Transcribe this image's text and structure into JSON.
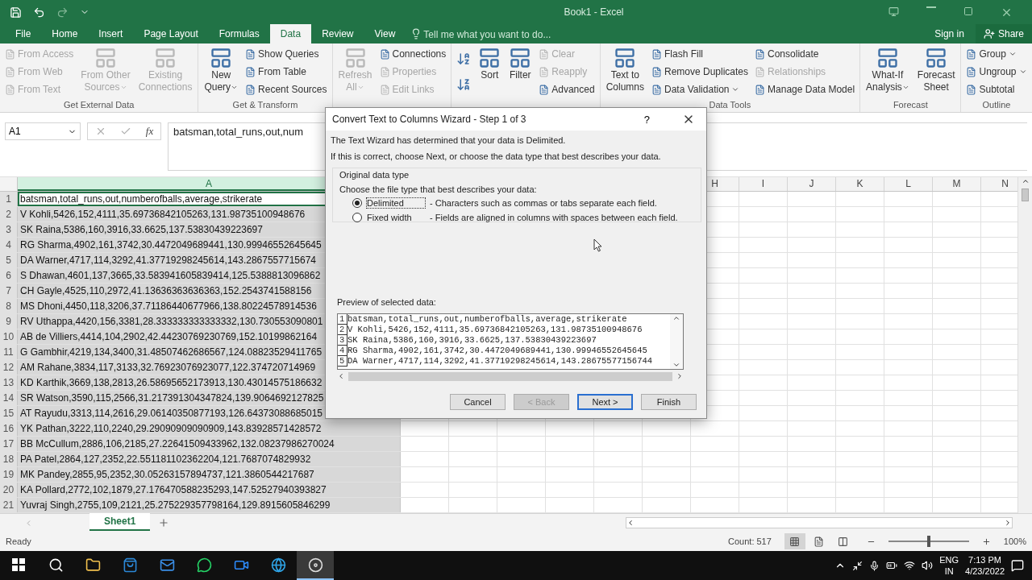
{
  "title_bar": {
    "title": "Book1 - Excel"
  },
  "menu_tabs": [
    {
      "label": "File",
      "selected": false
    },
    {
      "label": "Home",
      "selected": false
    },
    {
      "label": "Insert",
      "selected": false
    },
    {
      "label": "Page Layout",
      "selected": false
    },
    {
      "label": "Formulas",
      "selected": false
    },
    {
      "label": "Data",
      "selected": true
    },
    {
      "label": "Review",
      "selected": false
    },
    {
      "label": "View",
      "selected": false
    }
  ],
  "tell_me": {
    "placeholder": "Tell me what you want to do..."
  },
  "account": {
    "sign_in": "Sign in",
    "share": "Share"
  },
  "ribbon_groups": [
    {
      "title": "Get External Data",
      "items": [
        {
          "kind": "small",
          "label": "From Access",
          "disabled": true
        },
        {
          "kind": "small",
          "label": "From Web",
          "disabled": true
        },
        {
          "kind": "small",
          "label": "From Text",
          "disabled": true
        },
        {
          "kind": "large",
          "lines": [
            "From Other",
            "Sources"
          ],
          "dropdown": true,
          "disabled": true
        },
        {
          "kind": "large",
          "lines": [
            "Existing",
            "Connections"
          ],
          "dropdown": false,
          "disabled": true
        }
      ]
    },
    {
      "title": "Get & Transform",
      "items": [
        {
          "kind": "large",
          "lines": [
            "New",
            "Query"
          ],
          "dropdown": true,
          "disabled": false
        },
        {
          "kind": "small",
          "label": "Show Queries",
          "disabled": false
        },
        {
          "kind": "small",
          "label": "From Table",
          "disabled": false
        },
        {
          "kind": "small",
          "label": "Recent Sources",
          "disabled": false
        }
      ]
    },
    {
      "items": [
        {
          "kind": "large",
          "lines": [
            "Refresh",
            "All"
          ],
          "dropdown": true,
          "disabled": true
        },
        {
          "kind": "small",
          "label": "Connections",
          "disabled": false
        },
        {
          "kind": "small",
          "label": "Properties",
          "disabled": true
        },
        {
          "kind": "small",
          "label": "Edit Links",
          "disabled": true
        }
      ]
    },
    {
      "items": [
        {
          "kind": "sort_pair"
        },
        {
          "kind": "large",
          "lines": [
            "Sort"
          ],
          "dropdown": false,
          "disabled": false
        },
        {
          "kind": "large",
          "lines": [
            "Filter"
          ],
          "dropdown": false,
          "disabled": false
        },
        {
          "kind": "small",
          "label": "Clear",
          "disabled": true
        },
        {
          "kind": "small",
          "label": "Reapply",
          "disabled": true
        },
        {
          "kind": "small",
          "label": "Advanced",
          "disabled": false
        }
      ]
    },
    {
      "title": "Data Tools",
      "items": [
        {
          "kind": "large",
          "lines": [
            "Text to",
            "Columns"
          ],
          "dropdown": false,
          "disabled": false
        },
        {
          "kind": "small",
          "label": "Flash Fill",
          "disabled": false
        },
        {
          "kind": "small",
          "label": "Remove Duplicates",
          "disabled": false
        },
        {
          "kind": "small",
          "label": "Data Validation",
          "disabled": false,
          "dropdown": true
        },
        {
          "kind": "small",
          "label": "Consolidate",
          "disabled": false
        },
        {
          "kind": "small",
          "label": "Relationships",
          "disabled": true
        },
        {
          "kind": "small",
          "label": "Manage Data Model",
          "disabled": false
        }
      ]
    },
    {
      "title": "Forecast",
      "items": [
        {
          "kind": "large",
          "lines": [
            "What-If",
            "Analysis"
          ],
          "dropdown": true,
          "disabled": false
        },
        {
          "kind": "large",
          "lines": [
            "Forecast",
            "Sheet"
          ],
          "dropdown": false,
          "disabled": false
        }
      ]
    },
    {
      "title": "Outline",
      "items": [
        {
          "kind": "small",
          "label": "Group",
          "disabled": false,
          "dropdown": true
        },
        {
          "kind": "small",
          "label": "Ungroup",
          "disabled": false,
          "dropdown": true
        },
        {
          "kind": "small",
          "label": "Subtotal",
          "disabled": false
        }
      ]
    }
  ],
  "formula_bar": {
    "name_box": "A1",
    "function_button": "fx",
    "formula": "batsman,total_runs,out,num"
  },
  "columns": [
    {
      "label": "A",
      "selected": true
    },
    {
      "label": "H",
      "selected": false
    },
    {
      "label": "I",
      "selected": false
    },
    {
      "label": "J",
      "selected": false
    },
    {
      "label": "K",
      "selected": false
    },
    {
      "label": "L",
      "selected": false
    },
    {
      "label": "M",
      "selected": false
    },
    {
      "label": "N",
      "selected": false
    }
  ],
  "rows": [
    {
      "number": "1",
      "cell": "batsman,total_runs,out,numberofballs,average,strikerate",
      "active": true
    },
    {
      "number": "2",
      "cell": "V Kohli,5426,152,4111,35.69736842105263,131.98735100948676",
      "active": false
    },
    {
      "number": "3",
      "cell": "SK Raina,5386,160,3916,33.6625,137.53830439223697",
      "active": false
    },
    {
      "number": "4",
      "cell": "RG Sharma,4902,161,3742,30.4472049689441,130.99946552645645",
      "active": false
    },
    {
      "number": "5",
      "cell": "DA Warner,4717,114,3292,41.37719298245614,143.2867557715674",
      "active": false
    },
    {
      "number": "6",
      "cell": "S Dhawan,4601,137,3665,33.583941605839414,125.5388813096862",
      "active": false
    },
    {
      "number": "7",
      "cell": "CH Gayle,4525,110,2972,41.13636363636363,152.2543741588156",
      "active": false
    },
    {
      "number": "8",
      "cell": "MS Dhoni,4450,118,3206,37.71186440677966,138.80224578914536",
      "active": false
    },
    {
      "number": "9",
      "cell": "RV Uthappa,4420,156,3381,28.333333333333332,130.730553090801",
      "active": false
    },
    {
      "number": "10",
      "cell": "AB de Villiers,4414,104,2902,42.44230769230769,152.10199862164",
      "active": false
    },
    {
      "number": "11",
      "cell": "G Gambhir,4219,134,3400,31.48507462686567,124.08823529411765",
      "active": false
    },
    {
      "number": "12",
      "cell": "AM Rahane,3834,117,3133,32.76923076923077,122.374720714969",
      "active": false
    },
    {
      "number": "13",
      "cell": "KD Karthik,3669,138,2813,26.58695652173913,130.43014575186632",
      "active": false
    },
    {
      "number": "14",
      "cell": "SR Watson,3590,115,2566,31.217391304347824,139.9064692127825",
      "active": false
    },
    {
      "number": "15",
      "cell": "AT Rayudu,3313,114,2616,29.06140350877193,126.64373088685015",
      "active": false
    },
    {
      "number": "16",
      "cell": "YK Pathan,3222,110,2240,29.29090909090909,143.83928571428572",
      "active": false
    },
    {
      "number": "17",
      "cell": "BB McCullum,2886,106,2185,27.22641509433962,132.08237986270024",
      "active": false
    },
    {
      "number": "18",
      "cell": "PA Patel,2864,127,2352,22.551181102362204,121.7687074829932",
      "active": false
    },
    {
      "number": "19",
      "cell": "MK Pandey,2855,95,2352,30.05263157894737,121.3860544217687",
      "active": false
    },
    {
      "number": "20",
      "cell": "KA Pollard,2772,102,1879,27.176470588235293,147.52527940393827",
      "active": false
    },
    {
      "number": "21",
      "cell": "Yuvraj Singh,2755,109,2121,25.275229357798164,129.8915605846299",
      "active": false
    }
  ],
  "sheet_tabs": [
    {
      "label": "Sheet1",
      "selected": true
    }
  ],
  "status_bar": {
    "status": "Ready",
    "count": "Count: 517",
    "views": [
      {
        "selected": true
      },
      {
        "selected": false
      },
      {
        "selected": false
      }
    ],
    "zoom": {
      "level": 0.5,
      "reading": "100%"
    }
  },
  "dialog": {
    "title": "Convert Text to Columns Wizard - Step 1 of 3",
    "help": "?",
    "intro": "The Text Wizard has determined that your data is Delimited.",
    "hint": "If this is correct, choose Next, or choose the data type that best describes your data.",
    "group_title": "Original data type",
    "prompt": "Choose the file type that best describes your data:",
    "options": [
      {
        "label": "Delimited",
        "description": "- Characters such as commas or tabs separate each field.",
        "selected": true
      },
      {
        "label": "Fixed width",
        "description": "- Fields are aligned in columns with spaces between each field.",
        "selected": false
      }
    ],
    "preview_title": "Preview of selected data:",
    "preview": [
      {
        "number": "1",
        "text": "batsman,total_runs,out,numberofballs,average,strikerate"
      },
      {
        "number": "2",
        "text": "V Kohli,5426,152,4111,35.69736842105263,131.98735100948676"
      },
      {
        "number": "3",
        "text": "SK Raina,5386,160,3916,33.6625,137.53830439223697"
      },
      {
        "number": "4",
        "text": "RG Sharma,4902,161,3742,30.4472049689441,130.99946552645645"
      },
      {
        "number": "5",
        "text": "DA Warner,4717,114,3292,41.37719298245614,143.28675577156744"
      }
    ],
    "buttons": [
      {
        "label": "Cancel",
        "disabled": false,
        "default": false
      },
      {
        "label": "< Back",
        "disabled": true,
        "default": false
      },
      {
        "label": "Next >",
        "disabled": false,
        "default": true
      },
      {
        "label": "Finish",
        "disabled": false,
        "default": false
      }
    ]
  },
  "taskbar": {
    "apps": [
      {
        "selected": false
      },
      {
        "selected": false
      },
      {
        "selected": false
      },
      {
        "selected": false
      },
      {
        "selected": false
      },
      {
        "selected": false
      },
      {
        "selected": false
      },
      {
        "selected": true
      }
    ],
    "language": "ENG",
    "region": "IN",
    "time": "7:13 PM",
    "date": "4/23/2022"
  }
}
